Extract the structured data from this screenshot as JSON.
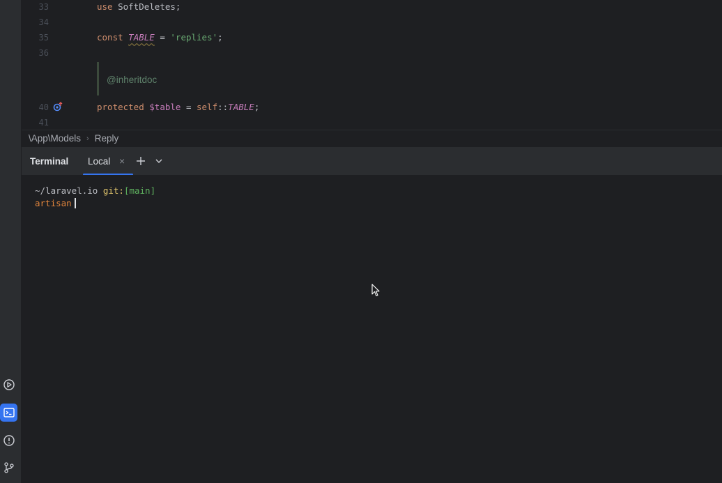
{
  "editor": {
    "lines": [
      {
        "no": "33",
        "keyword": "use",
        "text": "SoftDeletes;"
      },
      {
        "no": "34"
      },
      {
        "no": "35",
        "keyword": "const",
        "const_name": "TABLE",
        "operator": " = ",
        "string": "'replies'",
        "end": ";"
      },
      {
        "no": "36"
      },
      {
        "no": "40",
        "keyword": "protected",
        "variable": "$table",
        "operator": " = ",
        "self": "self",
        "scope": "::",
        "const_name": "TABLE",
        "end": ";"
      },
      {
        "no": "41"
      }
    ],
    "doc_comment": "@inheritdoc"
  },
  "breadcrumb": {
    "namespace": "\\App\\Models",
    "class": "Reply"
  },
  "terminal": {
    "title": "Terminal",
    "tab_label": "Local",
    "close_glyph": "×",
    "path": "~/laravel.io",
    "git_label": "git:",
    "branch": "[main]",
    "command": "artisan"
  },
  "colors": {
    "accent": "#3574f0",
    "background": "#1e1f22",
    "panel": "#2b2d30"
  },
  "icons": {
    "toolstrip": [
      "run-icon",
      "terminal-icon",
      "problems-icon",
      "git-branch-icon"
    ],
    "header": [
      "plus-icon",
      "chevron-down-icon"
    ],
    "gutter": "override-method-icon"
  }
}
